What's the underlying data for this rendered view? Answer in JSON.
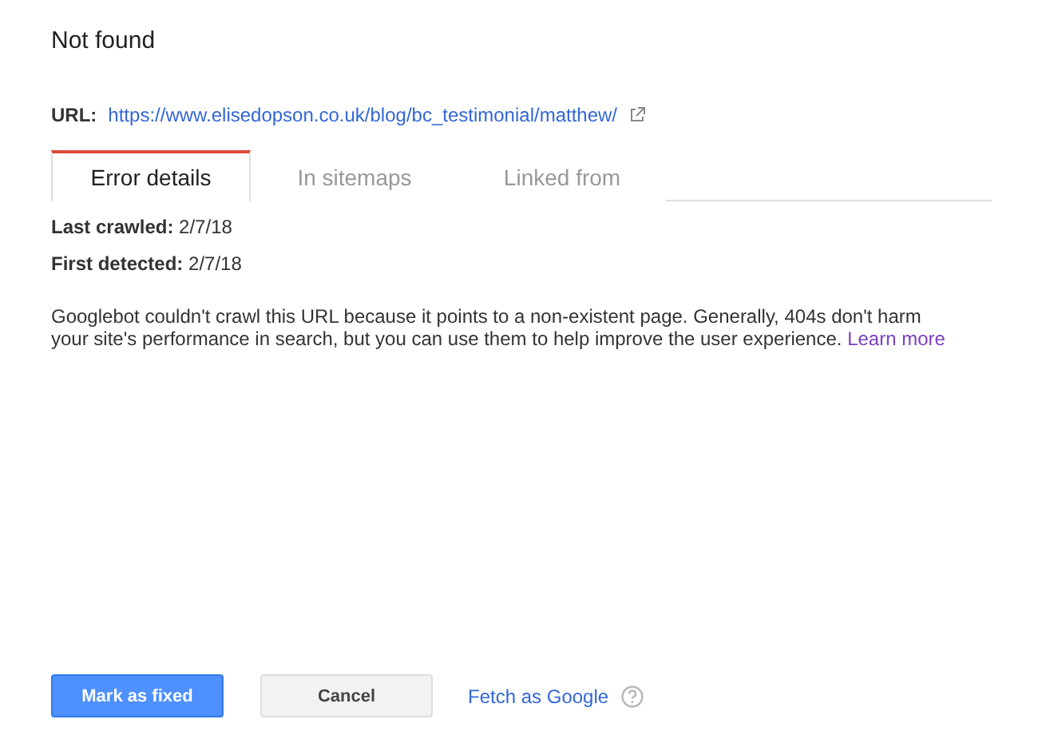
{
  "title": "Not found",
  "url": {
    "label": "URL:",
    "value": "https://www.elisedopson.co.uk/blog/bc_testimonial/matthew/"
  },
  "tabs": [
    {
      "label": "Error details",
      "selected": true
    },
    {
      "label": "In sitemaps",
      "selected": false
    },
    {
      "label": "Linked from",
      "selected": false
    }
  ],
  "details": [
    {
      "label": "Last crawled:",
      "value": "2/7/18"
    },
    {
      "label": "First detected:",
      "value": "2/7/18"
    }
  ],
  "description": {
    "text": "Googlebot couldn't crawl this URL because it points to a non-existent page. Generally, 404s don't harm your site's performance in search, but you can use them to help improve the user experience.",
    "link": "Learn more"
  },
  "actions": {
    "primary": "Mark as fixed",
    "secondary": "Cancel",
    "link": "Fetch as Google"
  }
}
